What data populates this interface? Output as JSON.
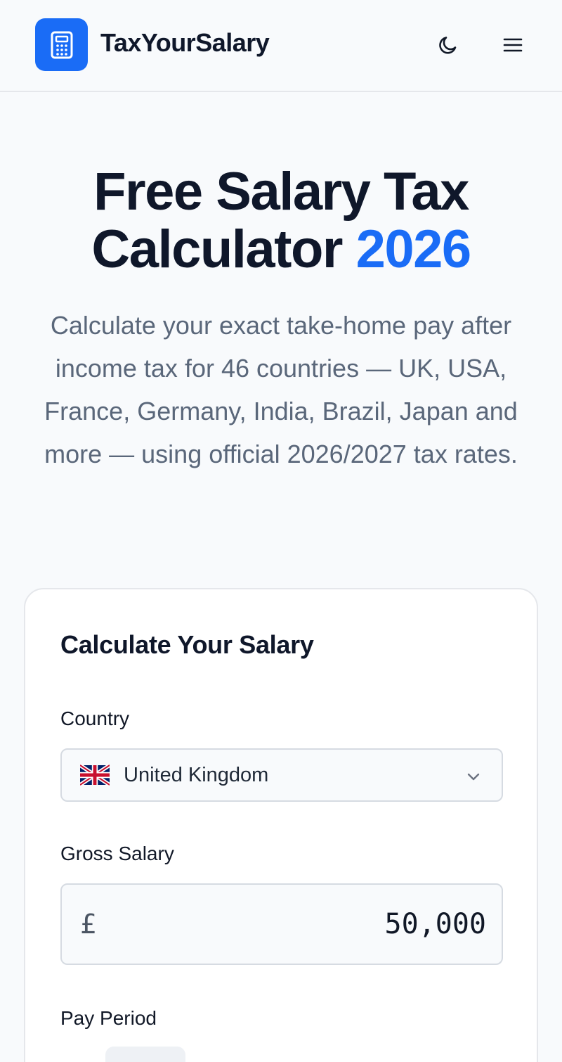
{
  "header": {
    "brand": "TaxYourSalary",
    "icons": {
      "logo": "calculator-icon",
      "theme": "moon-icon",
      "menu": "hamburger-menu-icon"
    }
  },
  "hero": {
    "title_main": "Free Salary Tax Calculator",
    "title_accent": "2026",
    "subtitle": "Calculate your exact take-home pay after income tax for 46 countries — UK, USA, France, Germany, India, Brazil, Japan and more — using official 2026/2027 tax rates."
  },
  "calculator": {
    "title": "Calculate Your Salary",
    "country": {
      "label": "Country",
      "selected": "United Kingdom",
      "flag": "uk-flag-icon"
    },
    "salary": {
      "label": "Gross Salary",
      "currency_symbol": "£",
      "value": "50,000"
    },
    "pay_period": {
      "label": "Pay Period"
    }
  },
  "colors": {
    "accent": "#1a6cf6",
    "text": "#0f172a",
    "muted": "#5a677a",
    "background": "#f8fafc"
  }
}
